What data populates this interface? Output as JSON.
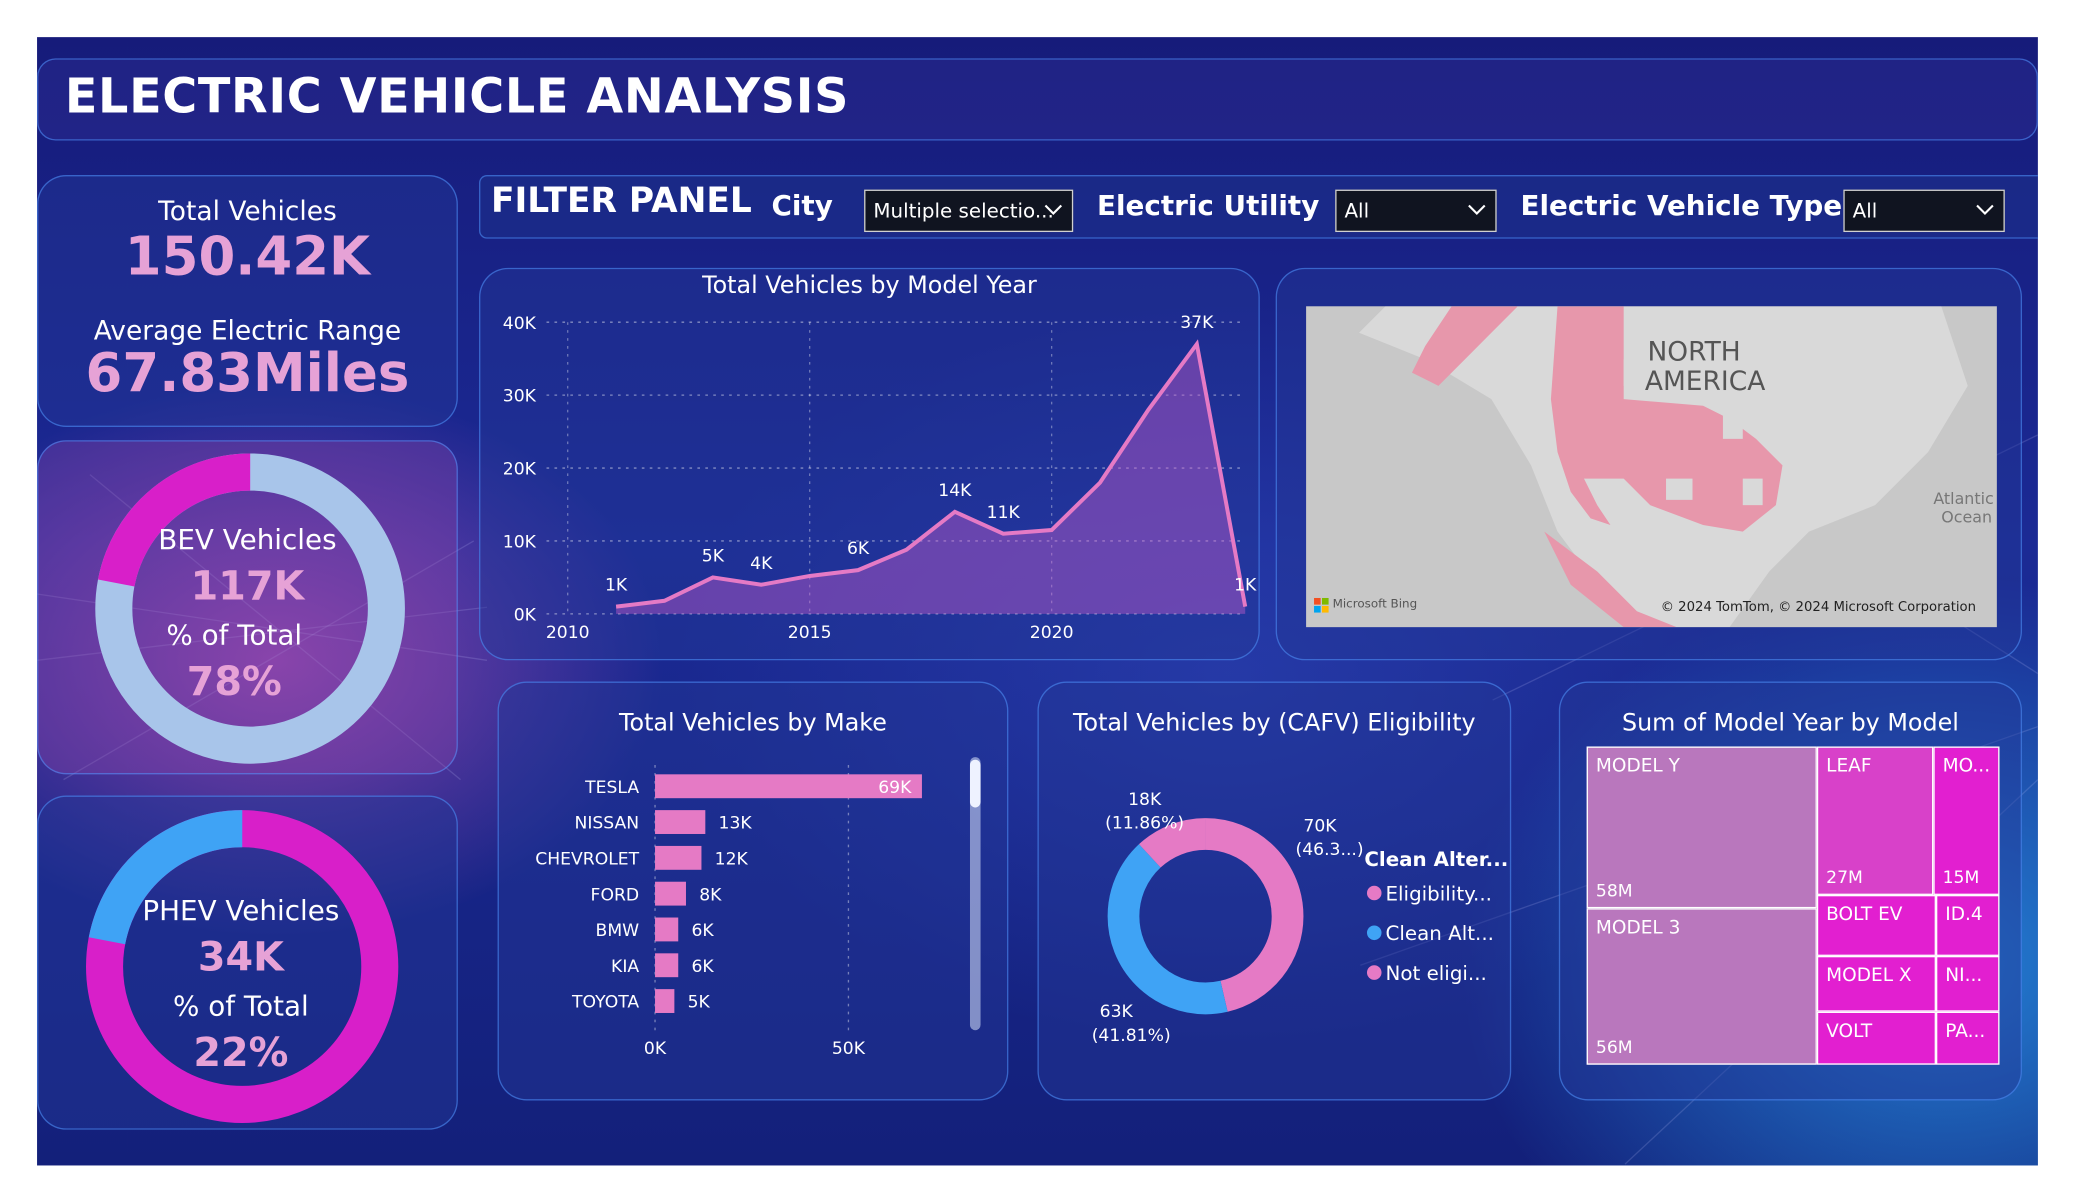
{
  "header": {
    "title": "ELECTRIC VEHICLE ANALYSIS"
  },
  "kpis": {
    "total_label": "Total Vehicles",
    "total_value": "150.42K",
    "range_label": "Average Electric Range",
    "range_value": "67.83Miles"
  },
  "bev": {
    "label": "BEV Vehicles",
    "value": "117K",
    "pct_label": "% of Total",
    "pct": "78%",
    "share": 0.78
  },
  "phev": {
    "label": "PHEV Vehicles",
    "value": "34K",
    "pct_label": "% of Total",
    "pct": "22%",
    "share": 0.22
  },
  "filters": {
    "title": "FILTER PANEL",
    "city_label": "City",
    "city_value": "Multiple selectio...",
    "utility_label": "Electric Utility",
    "utility_value": "All",
    "types_label": "Electric Vehicle Types",
    "types_value": "All"
  },
  "map": {
    "label_1": "NORTH",
    "label_2": "AMERICA",
    "ocean_1": "Atlantic",
    "ocean_2": "Ocean",
    "brand": "Microsoft Bing",
    "copyright": "© 2024 TomTom, © 2024 Microsoft Corporation"
  },
  "colors": {
    "pink": "#e57ac5",
    "blue": "#3fa3f5",
    "light_blue": "#a8c5ea",
    "magenta": "#d81fc9",
    "treemap_magenta": "#e21fd0"
  },
  "chart_data": [
    {
      "type": "area",
      "title": "Total Vehicles by Model Year",
      "x": [
        2011,
        2012,
        2013,
        2014,
        2015,
        2016,
        2017,
        2018,
        2019,
        2020,
        2021,
        2022,
        2023,
        2024
      ],
      "values": [
        1000,
        1800,
        5000,
        4000,
        5200,
        6000,
        8800,
        14000,
        11000,
        11500,
        18000,
        28000,
        37000,
        1000
      ],
      "data_labels": [
        {
          "x": 2011,
          "text": "1K"
        },
        {
          "x": 2013,
          "text": "5K"
        },
        {
          "x": 2014,
          "text": "4K"
        },
        {
          "x": 2016,
          "text": "6K"
        },
        {
          "x": 2018,
          "text": "14K"
        },
        {
          "x": 2019,
          "text": "11K"
        },
        {
          "x": 2023,
          "text": "37K"
        },
        {
          "x": 2024,
          "text": "1K"
        }
      ],
      "x_ticks": [
        2010,
        2015,
        2020
      ],
      "y_ticks": [
        {
          "v": 0,
          "t": "0K"
        },
        {
          "v": 10000,
          "t": "10K"
        },
        {
          "v": 20000,
          "t": "20K"
        },
        {
          "v": 30000,
          "t": "30K"
        },
        {
          "v": 40000,
          "t": "40K"
        }
      ],
      "xlim": [
        2010,
        2024
      ],
      "ylim": [
        0,
        40000
      ],
      "grid": true
    },
    {
      "type": "bar",
      "title": "Total Vehicles by Make",
      "categories": [
        "TESLA",
        "NISSAN",
        "CHEVROLET",
        "FORD",
        "BMW",
        "KIA",
        "TOYOTA"
      ],
      "values": [
        69000,
        13000,
        12000,
        8000,
        6000,
        6000,
        5000
      ],
      "labels": [
        "69K",
        "13K",
        "12K",
        "8K",
        "6K",
        "6K",
        "5K"
      ],
      "x_ticks": [
        {
          "v": 0,
          "t": "0K"
        },
        {
          "v": 50000,
          "t": "50K"
        }
      ],
      "xlim": [
        0,
        78000
      ]
    },
    {
      "type": "pie",
      "title": "Total Vehicles by (CAFV) Eligibility",
      "legend_title": "Clean Alter...",
      "legend_position": "right",
      "slices": [
        {
          "name": "Eligibility...",
          "value": 70000,
          "label": "70K",
          "pct": "(46.3...)",
          "color": "#e57ac5"
        },
        {
          "name": "Clean Alt...",
          "value": 63000,
          "label": "63K",
          "pct": "(41.81%)",
          "color": "#3fa3f5"
        },
        {
          "name": "Not eligi...",
          "value": 18000,
          "label": "18K",
          "pct": "(11.86%)",
          "color": "#e57ac5"
        }
      ]
    },
    {
      "type": "table",
      "title": "Sum of Model Year by Model",
      "tiles": [
        {
          "name": "MODEL Y",
          "value": "58M"
        },
        {
          "name": "MODEL 3",
          "value": "56M"
        },
        {
          "name": "LEAF",
          "value": "27M"
        },
        {
          "name": "MO...",
          "value": "15M"
        },
        {
          "name": "BOLT EV",
          "value": ""
        },
        {
          "name": "ID.4",
          "value": ""
        },
        {
          "name": "MODEL X",
          "value": ""
        },
        {
          "name": "NI...",
          "value": ""
        },
        {
          "name": "VOLT",
          "value": ""
        },
        {
          "name": "PA...",
          "value": ""
        }
      ]
    }
  ]
}
